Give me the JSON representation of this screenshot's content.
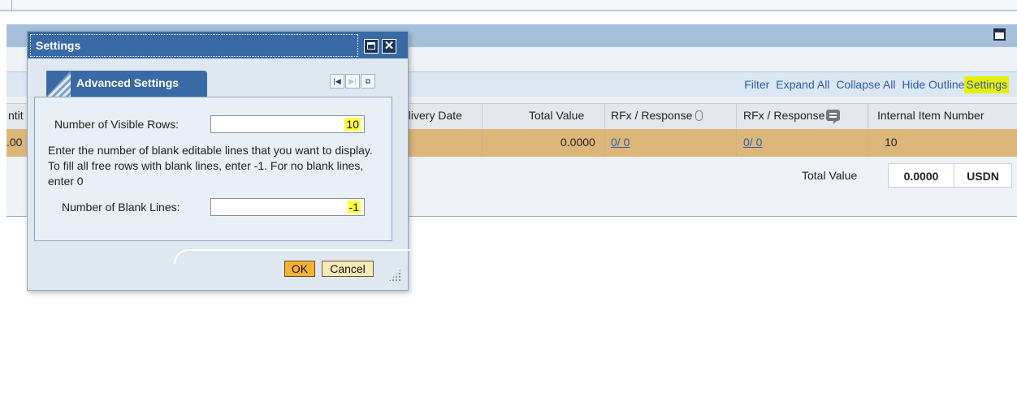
{
  "toolbar": {
    "links": [
      "Filter",
      "Expand All",
      "Collapse All",
      "Hide Outline",
      "Settings"
    ],
    "highlighted": "Settings",
    "highlight_color": "#e6ee0a",
    "link_color": "#2b5fa8"
  },
  "table": {
    "partial_left_header": "ntit",
    "partial_left_cell": ".00",
    "columns": {
      "delivery_date": "elivery Date",
      "total_value": "Total Value",
      "rfx_attach": "RFx / Response",
      "rfx_comment": "RFx / Response",
      "internal_item": "Internal Item Number"
    },
    "row": {
      "total_value": "0.0000",
      "rfx_attach": "0/ 0",
      "rfx_comment": "0/ 0",
      "internal_item": "10"
    },
    "row_color": "#ddb77a",
    "totals": {
      "label": "Total Value",
      "value": "0.0000",
      "currency": "USDN"
    }
  },
  "dialog": {
    "title": "Settings",
    "close_glyph": "✕",
    "tab_label": "Advanced Settings",
    "nav_icons": [
      "first-page-icon",
      "last-page-icon",
      "restore-icon"
    ],
    "visible_rows_label": "Number of Visible Rows:",
    "visible_rows_value": "10",
    "description": "Enter the number of blank editable lines that you want to display. To fill all free rows with blank lines, enter -1. For no blank lines, enter 0",
    "blank_lines_label": "Number of Blank Lines:",
    "blank_lines_value": "-1",
    "ok_label": "OK",
    "cancel_label": "Cancel",
    "titlebar_color": "#3a6aa6",
    "field_highlight_color": "#ffff40"
  }
}
